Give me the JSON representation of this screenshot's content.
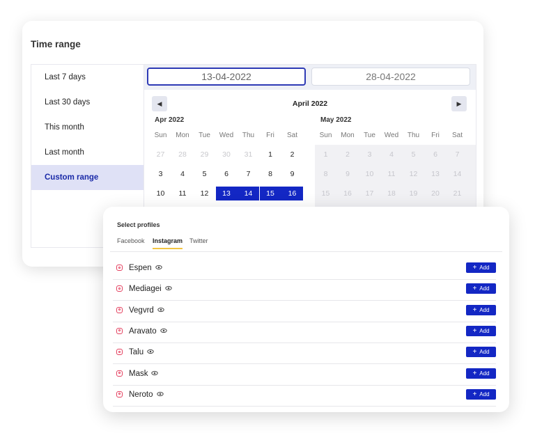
{
  "time_range": {
    "title": "Time range",
    "presets": [
      "Last 7 days",
      "Last 30 days",
      "This month",
      "Last month",
      "Custom range"
    ],
    "active_preset": "Custom range",
    "start_date": "13-04-2022",
    "end_date": "28-04-2022",
    "nav_prev_icon": "◀",
    "nav_next_icon": "▶",
    "header_month": "April 2022",
    "left_month": {
      "label": "Apr 2022",
      "weekdays": [
        "Sun",
        "Mon",
        "Tue",
        "Wed",
        "Thu",
        "Fri",
        "Sat"
      ],
      "weeks": [
        [
          "27",
          "28",
          "29",
          "30",
          "31",
          "1",
          "2"
        ],
        [
          "3",
          "4",
          "5",
          "6",
          "7",
          "8",
          "9"
        ],
        [
          "10",
          "11",
          "12",
          "13",
          "14",
          "15",
          "16"
        ]
      ]
    },
    "right_month": {
      "label": "May 2022",
      "weekdays": [
        "Sun",
        "Mon",
        "Tue",
        "Wed",
        "Thu",
        "Fri",
        "Sat"
      ],
      "weeks": [
        [
          "1",
          "2",
          "3",
          "4",
          "5",
          "6",
          "7"
        ],
        [
          "8",
          "9",
          "10",
          "11",
          "12",
          "13",
          "14"
        ],
        [
          "15",
          "16",
          "17",
          "18",
          "19",
          "20",
          "21"
        ]
      ]
    }
  },
  "profiles": {
    "title": "Select profiles",
    "tabs": [
      "Facebook",
      "Instagram",
      "Twitter"
    ],
    "active_tab": "Instagram",
    "add_label": "Add",
    "items": [
      {
        "name": "Espen"
      },
      {
        "name": "Mediagei"
      },
      {
        "name": "Vegvrd"
      },
      {
        "name": "Aravato"
      },
      {
        "name": "Talu"
      },
      {
        "name": "Mask"
      },
      {
        "name": "Neroto"
      }
    ]
  },
  "colors": {
    "accent": "#1327c4",
    "selected_preset_bg": "#dfe1f6",
    "instagram": "#e4405f",
    "tab_underline": "#f3c542"
  }
}
